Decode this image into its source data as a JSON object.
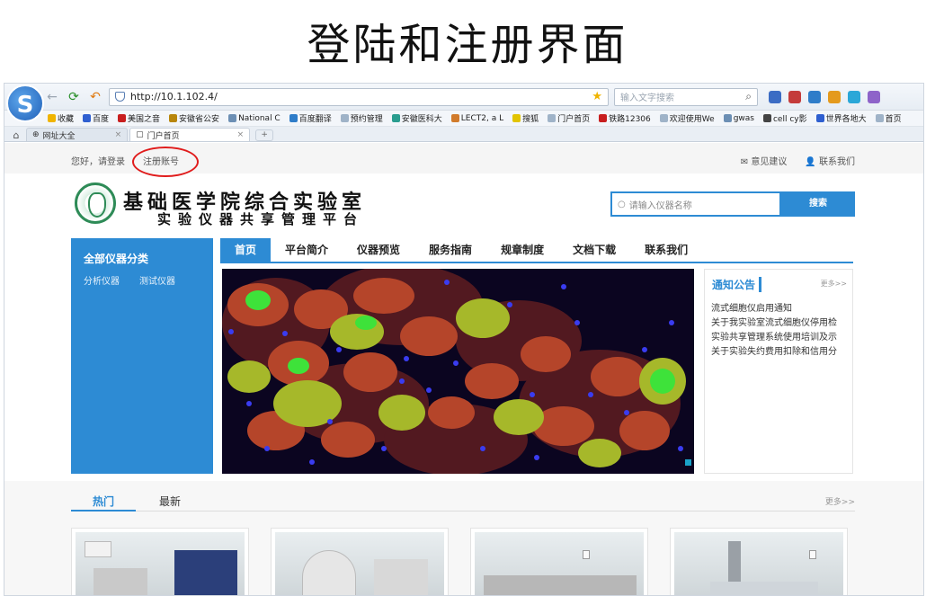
{
  "slide": {
    "title": "登陆和注册界面"
  },
  "browser": {
    "logo": "S",
    "url": "http://10.1.102.4/",
    "search_placeholder": "输入文字搜索",
    "bookmarks": [
      "收藏",
      "百度",
      "美国之音",
      "安徽省公安",
      "National C",
      "百度翻译",
      "预约管理",
      "安徽医科大",
      "LECT2, a L",
      "搜狐",
      "门户首页",
      "铁路12306",
      "欢迎使用We",
      "gwas",
      "cell cy影",
      "世界各地大",
      "首页"
    ],
    "tabs": [
      {
        "label": "网址大全",
        "active": false
      },
      {
        "label": "门户首页",
        "active": true
      }
    ],
    "tab_add": "+"
  },
  "topbar": {
    "greeting": "您好，请登录",
    "register": "注册账号",
    "feedback": "✉ 意见建议",
    "contact": "👤 联系我们"
  },
  "header": {
    "title": "基础医学院综合实验室",
    "subtitle": "实验仪器共享管理平台",
    "search_placeholder": "请输入仪器名称",
    "search_button": "搜索"
  },
  "sidebar": {
    "title": "全部仪器分类",
    "links": [
      "分析仪器",
      "测试仪器"
    ]
  },
  "nav": {
    "items": [
      "首页",
      "平台简介",
      "仪器预览",
      "服务指南",
      "规章制度",
      "文档下载",
      "联系我们"
    ]
  },
  "notice": {
    "title": "通知公告",
    "more": "更多>>",
    "items": [
      "流式细胞仪启用通知",
      "关于我实验室流式细胞仪停用检",
      "实验共享管理系统使用培训及示",
      "关于实验失约费用扣除和信用分"
    ]
  },
  "lower": {
    "tabs": [
      "热门",
      "最新"
    ],
    "more": "更多>>"
  },
  "colors": {
    "accent": "#2d8bd4",
    "circle": "#e01c1c"
  }
}
